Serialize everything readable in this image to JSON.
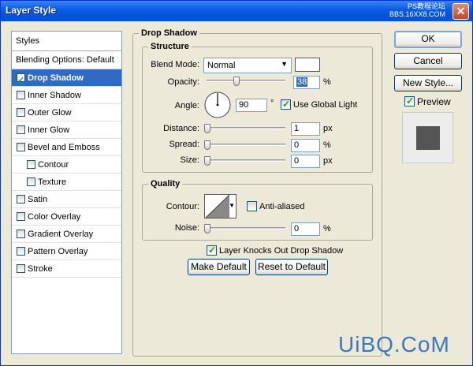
{
  "window": {
    "title": "Layer Style",
    "watermark_line1": "PS教程论坛",
    "watermark_line2": "BBS.16XX8.COM"
  },
  "styles_panel": {
    "header": "Styles",
    "blending_options": "Blending Options: Default",
    "items": [
      {
        "label": "Drop Shadow",
        "checked": true,
        "selected": true
      },
      {
        "label": "Inner Shadow",
        "checked": false
      },
      {
        "label": "Outer Glow",
        "checked": false
      },
      {
        "label": "Inner Glow",
        "checked": false
      },
      {
        "label": "Bevel and Emboss",
        "checked": false
      },
      {
        "label": "Contour",
        "checked": false,
        "sub": true
      },
      {
        "label": "Texture",
        "checked": false,
        "sub": true
      },
      {
        "label": "Satin",
        "checked": false
      },
      {
        "label": "Color Overlay",
        "checked": false
      },
      {
        "label": "Gradient Overlay",
        "checked": false
      },
      {
        "label": "Pattern Overlay",
        "checked": false
      },
      {
        "label": "Stroke",
        "checked": false
      }
    ]
  },
  "drop_shadow": {
    "title": "Drop Shadow",
    "structure": {
      "title": "Structure",
      "blend_mode_label": "Blend Mode:",
      "blend_mode_value": "Normal",
      "opacity_label": "Opacity:",
      "opacity_value": "38",
      "opacity_unit": "%",
      "opacity_fraction": 0.38,
      "angle_label": "Angle:",
      "angle_value": "90",
      "angle_unit": "°",
      "use_global_light": "Use Global Light",
      "distance_label": "Distance:",
      "distance_value": "1",
      "distance_unit": "px",
      "spread_label": "Spread:",
      "spread_value": "0",
      "spread_unit": "%",
      "size_label": "Size:",
      "size_value": "0",
      "size_unit": "px"
    },
    "quality": {
      "title": "Quality",
      "contour_label": "Contour:",
      "anti_aliased": "Anti-aliased",
      "noise_label": "Noise:",
      "noise_value": "0",
      "noise_unit": "%"
    },
    "layer_knocks_out": "Layer Knocks Out Drop Shadow",
    "make_default": "Make Default",
    "reset_to_default": "Reset to Default"
  },
  "right": {
    "ok": "OK",
    "cancel": "Cancel",
    "new_style": "New Style...",
    "preview": "Preview"
  },
  "footer_watermark": "UiBQ.CoM",
  "colors": {
    "selection": "#316ac5",
    "shadow_color": "#ffffff",
    "preview_swatch": "#555555"
  }
}
